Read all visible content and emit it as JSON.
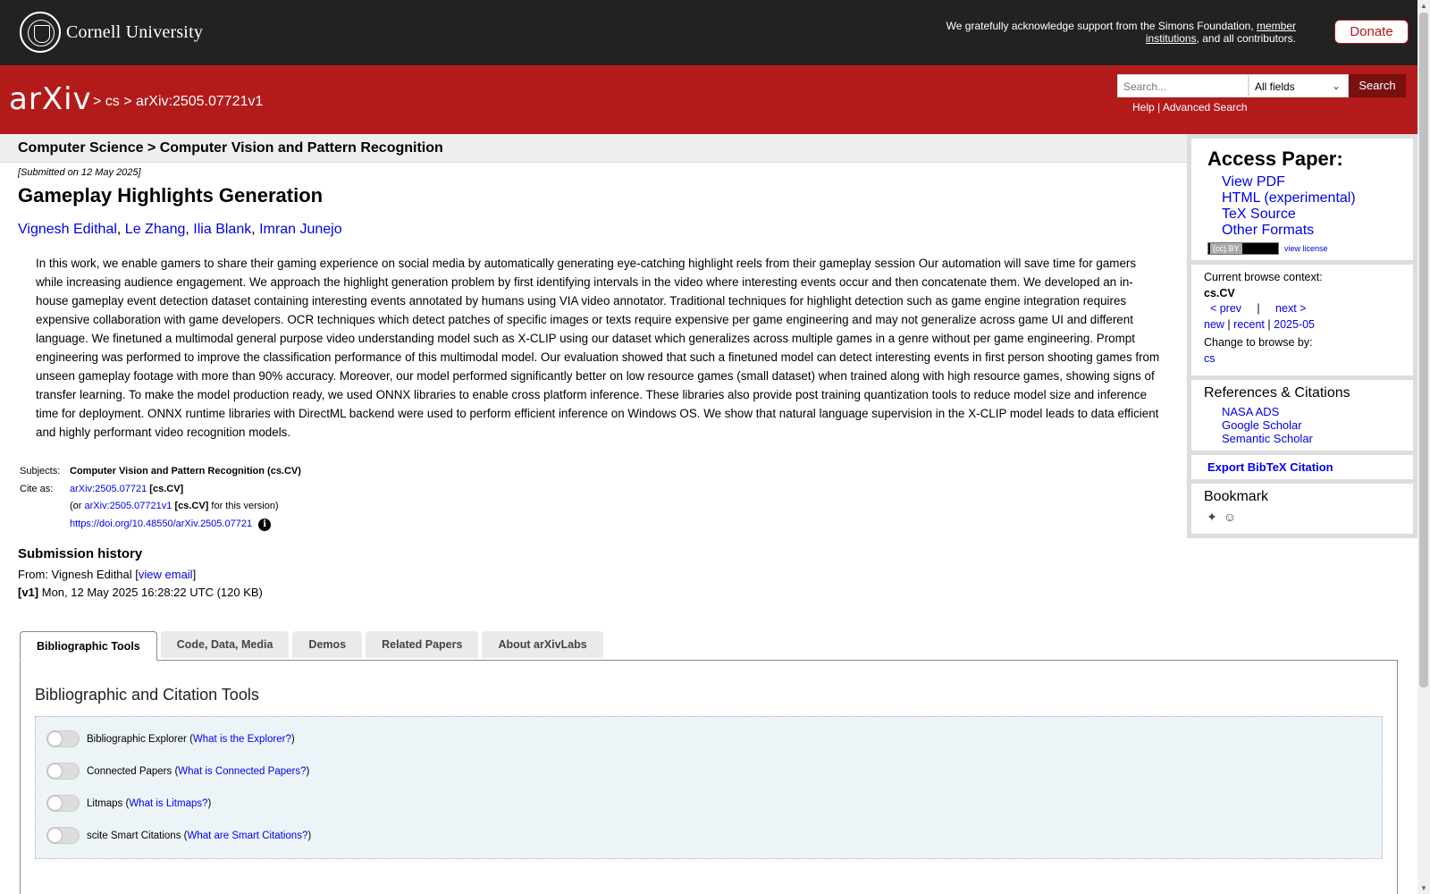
{
  "cornell": {
    "name": "Cornell University",
    "support_text": "We gratefully acknowledge support from the Simons Foundation,",
    "member_link": "member institutions",
    "support_tail": ", and all contributors.",
    "donate": "Donate"
  },
  "arxiv_bar": {
    "logo": "arXiv",
    "crumb_sep1": ">",
    "crumb_cs": "cs",
    "crumb_sep2": ">",
    "crumb_id": "arXiv:2505.07721v1",
    "search_placeholder": "Search...",
    "search_field": "All fields",
    "search_button": "Search",
    "help": "Help",
    "sep": "|",
    "advanced": "Advanced Search"
  },
  "subheader": {
    "title": "Computer Science > Computer Vision and Pattern Recognition"
  },
  "paper": {
    "submitted": "[Submitted on 12 May 2025]",
    "title": "Gameplay Highlights Generation",
    "authors": [
      "Vignesh Edithal",
      "Le Zhang",
      "Ilia Blank",
      "Imran Junejo"
    ],
    "abstract": "In this work, we enable gamers to share their gaming experience on social media by automatically generating eye-catching highlight reels from their gameplay session Our automation will save time for gamers while increasing audience engagement. We approach the highlight generation problem by first identifying intervals in the video where interesting events occur and then concatenate them. We developed an in-house gameplay event detection dataset containing interesting events annotated by humans using VIA video annotator. Traditional techniques for highlight detection such as game engine integration requires expensive collaboration with game developers. OCR techniques which detect patches of specific images or texts require expensive per game engineering and may not generalize across game UI and different language. We finetuned a multimodal general purpose video understanding model such as X-CLIP using our dataset which generalizes across multiple games in a genre without per game engineering. Prompt engineering was performed to improve the classification performance of this multimodal model. Our evaluation showed that such a finetuned model can detect interesting events in first person shooting games from unseen gameplay footage with more than 90% accuracy. Moreover, our model performed significantly better on low resource games (small dataset) when trained along with high resource games, showing signs of transfer learning. To make the model production ready, we used ONNX libraries to enable cross platform inference. These libraries also provide post training quantization tools to reduce model size and inference time for deployment. ONNX runtime libraries with DirectML backend were used to perform efficient inference on Windows OS. We show that natural language supervision in the X-CLIP model leads to data efficient and highly performant video recognition models."
  },
  "meta": {
    "subjects_label": "Subjects:",
    "subjects_value": "Computer Vision and Pattern Recognition (cs.CV)",
    "cite_label": "Cite as:",
    "cite_id": "arXiv:2505.07721",
    "cite_cat": "[cs.CV]",
    "or_prefix": "(or",
    "cite_v1": "arXiv:2505.07721v1",
    "cite_v1_cat": "[cs.CV]",
    "or_suffix": "for this version)",
    "doi": "https://doi.org/10.48550/arXiv.2505.07721",
    "info": "i"
  },
  "history": {
    "title": "Submission history",
    "from_prefix": "From: Vignesh Edithal [",
    "view_email": "view email",
    "from_suffix": "]",
    "v1_label": "[v1]",
    "v1_text": "Mon, 12 May 2025 16:28:22 UTC (120 KB)"
  },
  "tabs": [
    "Bibliographic Tools",
    "Code, Data, Media",
    "Demos",
    "Related Papers",
    "About arXivLabs"
  ],
  "tools": {
    "title": "Bibliographic and Citation Tools",
    "items": [
      {
        "label": "Bibliographic Explorer",
        "link": "What is the Explorer?"
      },
      {
        "label": "Connected Papers",
        "link": "What is Connected Papers?"
      },
      {
        "label": "Litmaps",
        "link": "What is Litmaps?"
      },
      {
        "label": "scite Smart Citations",
        "link": "What are Smart Citations?"
      }
    ]
  },
  "sidebar": {
    "access_title": "Access Paper:",
    "access_links": [
      "View PDF",
      "HTML (experimental)",
      "TeX Source",
      "Other Formats"
    ],
    "cc": "(cc) BY",
    "view_license": "view license",
    "context_label": "Current browse context:",
    "context_value": "cs.CV",
    "prev": "< prev",
    "sep": "|",
    "next": "next >",
    "new": "new",
    "recent": "recent",
    "month": "2025-05",
    "change_label": "Change to browse by:",
    "change_value": "cs",
    "refs_title": "References & Citations",
    "refs": [
      "NASA ADS",
      "Google Scholar",
      "Semantic Scholar"
    ],
    "export": "Export BibTeX Citation",
    "bookmark_title": "Bookmark"
  }
}
